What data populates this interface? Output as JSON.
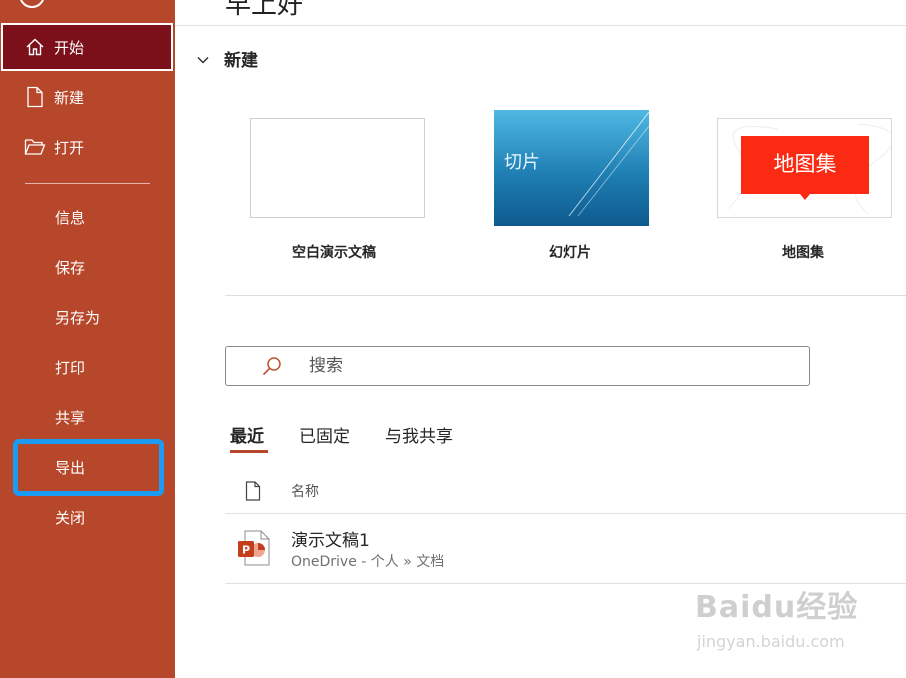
{
  "sidebar": {
    "items": [
      {
        "label": "开始",
        "icon": "home-icon",
        "active": true
      },
      {
        "label": "新建",
        "icon": "new-file-icon"
      },
      {
        "label": "打开",
        "icon": "folder-open-icon"
      },
      {
        "label": "信息"
      },
      {
        "label": "保存"
      },
      {
        "label": "另存为"
      },
      {
        "label": "打印"
      },
      {
        "label": "共享"
      },
      {
        "label": "导出",
        "highlighted": true
      },
      {
        "label": "关闭"
      }
    ],
    "colors": {
      "background": "#b7472a",
      "active": "#7b0f1a",
      "highlight": "#1b9cf2"
    }
  },
  "main": {
    "title": "早上好",
    "new_section": {
      "label": "新建",
      "templates": [
        {
          "label": "空白演示文稿",
          "thumb_text": ""
        },
        {
          "label": "幻灯片",
          "thumb_text": "切片"
        },
        {
          "label": "地图集",
          "thumb_text": "地图集"
        }
      ]
    },
    "search": {
      "placeholder": "搜索",
      "value": ""
    },
    "tabs": [
      {
        "label": "最近",
        "active": true
      },
      {
        "label": "已固定"
      },
      {
        "label": "与我共享"
      }
    ],
    "file_list": {
      "column_header": "名称",
      "files": [
        {
          "name": "演示文稿1",
          "path": "OneDrive - 个人 » 文档",
          "icon": "powerpoint-file-icon"
        }
      ]
    }
  },
  "watermark": {
    "main": "Baidu经验",
    "sub": "jingyan.baidu.com"
  }
}
